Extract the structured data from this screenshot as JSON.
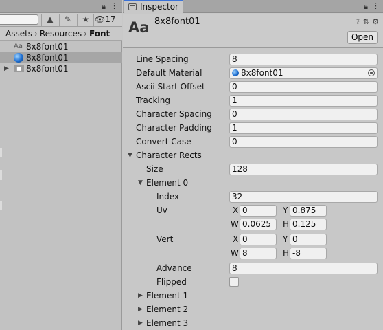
{
  "project": {
    "hidden_count": "17",
    "breadcrumb": [
      "Assets",
      "Resources",
      "Font"
    ],
    "files": [
      {
        "label": "8x8font01",
        "icon": "font-icon"
      },
      {
        "label": "8x8font01",
        "icon": "material-icon"
      },
      {
        "label": "8x8font01",
        "icon": "texture-icon"
      }
    ]
  },
  "inspector": {
    "tab_label": "Inspector",
    "asset_icon_text": "Aa",
    "asset_title": "8x8font01",
    "open_label": "Open",
    "fields": {
      "line_spacing": {
        "label": "Line Spacing",
        "value": "8"
      },
      "default_material": {
        "label": "Default Material",
        "value": "8x8font01"
      },
      "ascii_start_offset": {
        "label": "Ascii Start Offset",
        "value": "0"
      },
      "tracking": {
        "label": "Tracking",
        "value": "1"
      },
      "character_spacing": {
        "label": "Character Spacing",
        "value": "0"
      },
      "character_padding": {
        "label": "Character Padding",
        "value": "1"
      },
      "convert_case": {
        "label": "Convert Case",
        "value": "0"
      }
    },
    "character_rects": {
      "label": "Character Rects",
      "size_label": "Size",
      "size_value": "128",
      "element0": {
        "label": "Element 0",
        "index_label": "Index",
        "index_value": "32",
        "uv_label": "Uv",
        "uv": {
          "x_label": "X",
          "x": "0",
          "y_label": "Y",
          "y": "0.875",
          "w_label": "W",
          "w": "0.0625",
          "h_label": "H",
          "h": "0.125"
        },
        "vert_label": "Vert",
        "vert": {
          "x_label": "X",
          "x": "0",
          "y_label": "Y",
          "y": "0",
          "w_label": "W",
          "w": "8",
          "h_label": "H",
          "h": "-8"
        },
        "advance_label": "Advance",
        "advance_value": "8",
        "flipped_label": "Flipped",
        "flipped": false
      },
      "collapsed": [
        "Element 1",
        "Element 2",
        "Element 3"
      ]
    }
  },
  "colors": {
    "tab_accent": "#3a72d8",
    "selection": "#a6a6a6",
    "field_bg": "#f0f0f0"
  }
}
